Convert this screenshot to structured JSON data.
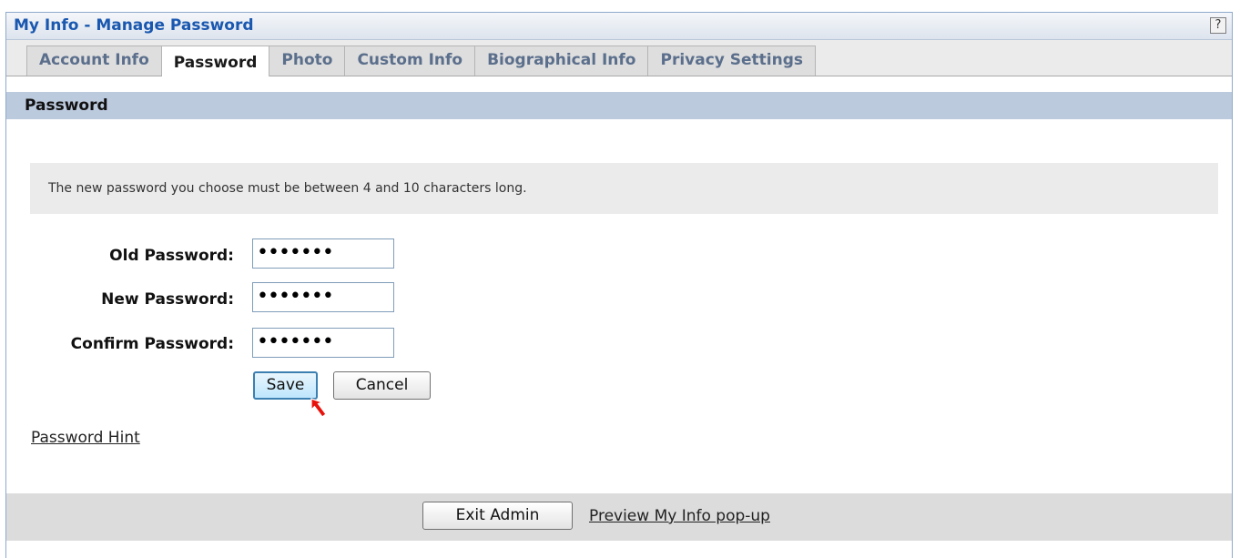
{
  "header": {
    "title": "My Info - Manage Password",
    "help": "?"
  },
  "tabs": [
    {
      "label": "Account Info"
    },
    {
      "label": "Password"
    },
    {
      "label": "Photo"
    },
    {
      "label": "Custom Info"
    },
    {
      "label": "Biographical Info"
    },
    {
      "label": "Privacy Settings"
    }
  ],
  "section": {
    "title": "Password"
  },
  "info": {
    "text": "The new password you choose must be between 4 and 10 characters long."
  },
  "form": {
    "old_label": "Old Password:",
    "old_value": "•••••••",
    "new_label": "New Password:",
    "new_value": "•••••••",
    "confirm_label": "Confirm Password:",
    "confirm_value": "•••••••",
    "save_label": "Save",
    "cancel_label": "Cancel"
  },
  "links": {
    "password_hint": "Password Hint"
  },
  "footer": {
    "exit_label": "Exit Admin",
    "preview_label": "Preview My Info pop-up"
  },
  "icons": {
    "cursor": "mouse-pointer-icon",
    "cursor_color": "#e8120c"
  }
}
